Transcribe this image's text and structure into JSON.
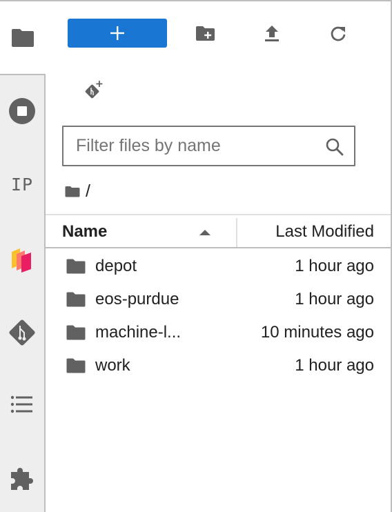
{
  "sidebar": {
    "tabs": [
      {
        "id": "file-browser",
        "icon": "folder-icon",
        "active": true
      },
      {
        "id": "running",
        "icon": "stop-circle-icon"
      },
      {
        "id": "property-inspector",
        "icon": "ip-text-icon",
        "label": "IP"
      },
      {
        "id": "extension-stack",
        "icon": "stacked-cards-icon",
        "colors": [
          "#fbc02d",
          "#ff7a6b",
          "#e91e63"
        ]
      },
      {
        "id": "git",
        "icon": "git-icon"
      },
      {
        "id": "table-of-contents",
        "icon": "list-icon"
      },
      {
        "id": "extension-manager",
        "icon": "puzzle-icon"
      }
    ]
  },
  "toolbar": {
    "new_launcher_label": "+",
    "new_folder": "new-folder-icon",
    "upload": "upload-icon",
    "refresh": "refresh-icon",
    "git_clone": "git-clone-icon",
    "accent_color": "#1976d2"
  },
  "filter": {
    "placeholder": "Filter files by name",
    "value": ""
  },
  "breadcrumb": {
    "path": "/"
  },
  "table": {
    "columns": {
      "name": "Name",
      "modified": "Last Modified",
      "sort": "ascending"
    },
    "rows": [
      {
        "name": "depot",
        "type": "folder",
        "modified": "1 hour ago"
      },
      {
        "name": "eos-purdue",
        "type": "folder",
        "modified": "1 hour ago"
      },
      {
        "name": "machine-l...",
        "type": "folder",
        "modified": "10 minutes ago"
      },
      {
        "name": "work",
        "type": "folder",
        "modified": "1 hour ago"
      }
    ]
  }
}
